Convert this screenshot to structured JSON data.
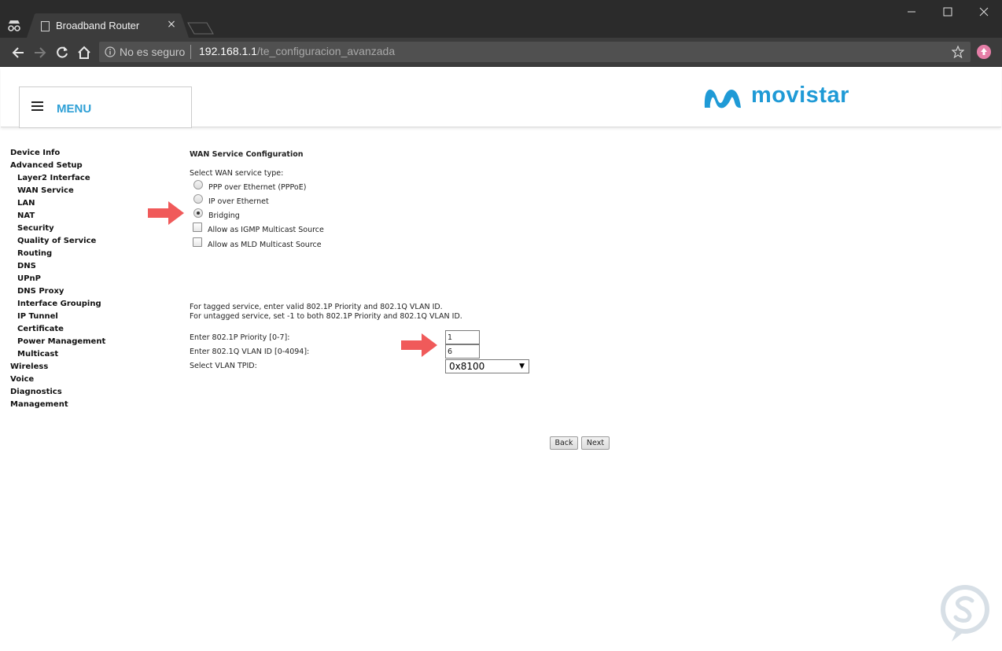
{
  "browser": {
    "tab_title": "Broadband Router",
    "tab_close": "×",
    "security_label": "No es seguro",
    "url_host": "192.168.1.1",
    "url_path": "/te_configuracion_avanzada"
  },
  "header": {
    "menu_label": "MENU",
    "brand": "movistar",
    "brand_color": "#1f9ad6"
  },
  "sidebar": {
    "items": [
      {
        "label": "Device Info",
        "level": 0
      },
      {
        "label": "Advanced Setup",
        "level": 0
      },
      {
        "label": "Layer2 Interface",
        "level": 1
      },
      {
        "label": "WAN Service",
        "level": 1
      },
      {
        "label": "LAN",
        "level": 1
      },
      {
        "label": "NAT",
        "level": 1
      },
      {
        "label": "Security",
        "level": 1
      },
      {
        "label": "Quality of Service",
        "level": 1
      },
      {
        "label": "Routing",
        "level": 1
      },
      {
        "label": "DNS",
        "level": 1
      },
      {
        "label": "UPnP",
        "level": 1
      },
      {
        "label": "DNS Proxy",
        "level": 1
      },
      {
        "label": "Interface Grouping",
        "level": 1
      },
      {
        "label": "IP Tunnel",
        "level": 1
      },
      {
        "label": "Certificate",
        "level": 1
      },
      {
        "label": "Power Management",
        "level": 1
      },
      {
        "label": "Multicast",
        "level": 1
      },
      {
        "label": "Wireless",
        "level": 0
      },
      {
        "label": "Voice",
        "level": 0
      },
      {
        "label": "Diagnostics",
        "level": 0
      },
      {
        "label": "Management",
        "level": 0
      }
    ]
  },
  "main": {
    "title": "WAN Service Configuration",
    "select_type_label": "Select WAN service type:",
    "options": {
      "pppoe": "PPP over Ethernet (PPPoE)",
      "ipoe": "IP over Ethernet",
      "bridging": "Bridging"
    },
    "selected_option": "bridging",
    "checkboxes": {
      "igmp": "Allow as IGMP Multicast Source",
      "mld": "Allow as MLD Multicast Source"
    },
    "tagged_note": "For tagged service, enter valid 802.1P Priority and 802.1Q VLAN ID.",
    "untagged_note": "For untagged service, set -1 to both 802.1P Priority and 802.1Q VLAN ID.",
    "priority_label": "Enter 802.1P Priority [0-7]:",
    "priority_value": "1",
    "vlan_label": "Enter 802.1Q VLAN ID [0-4094]:",
    "vlan_value": "6",
    "tpid_label": "Select VLAN TPID:",
    "tpid_value": "0x8100",
    "back_label": "Back",
    "next_label": "Next"
  },
  "colors": {
    "annotation_arrow": "#f05a5a",
    "menu_accent": "#2fa0d6"
  }
}
